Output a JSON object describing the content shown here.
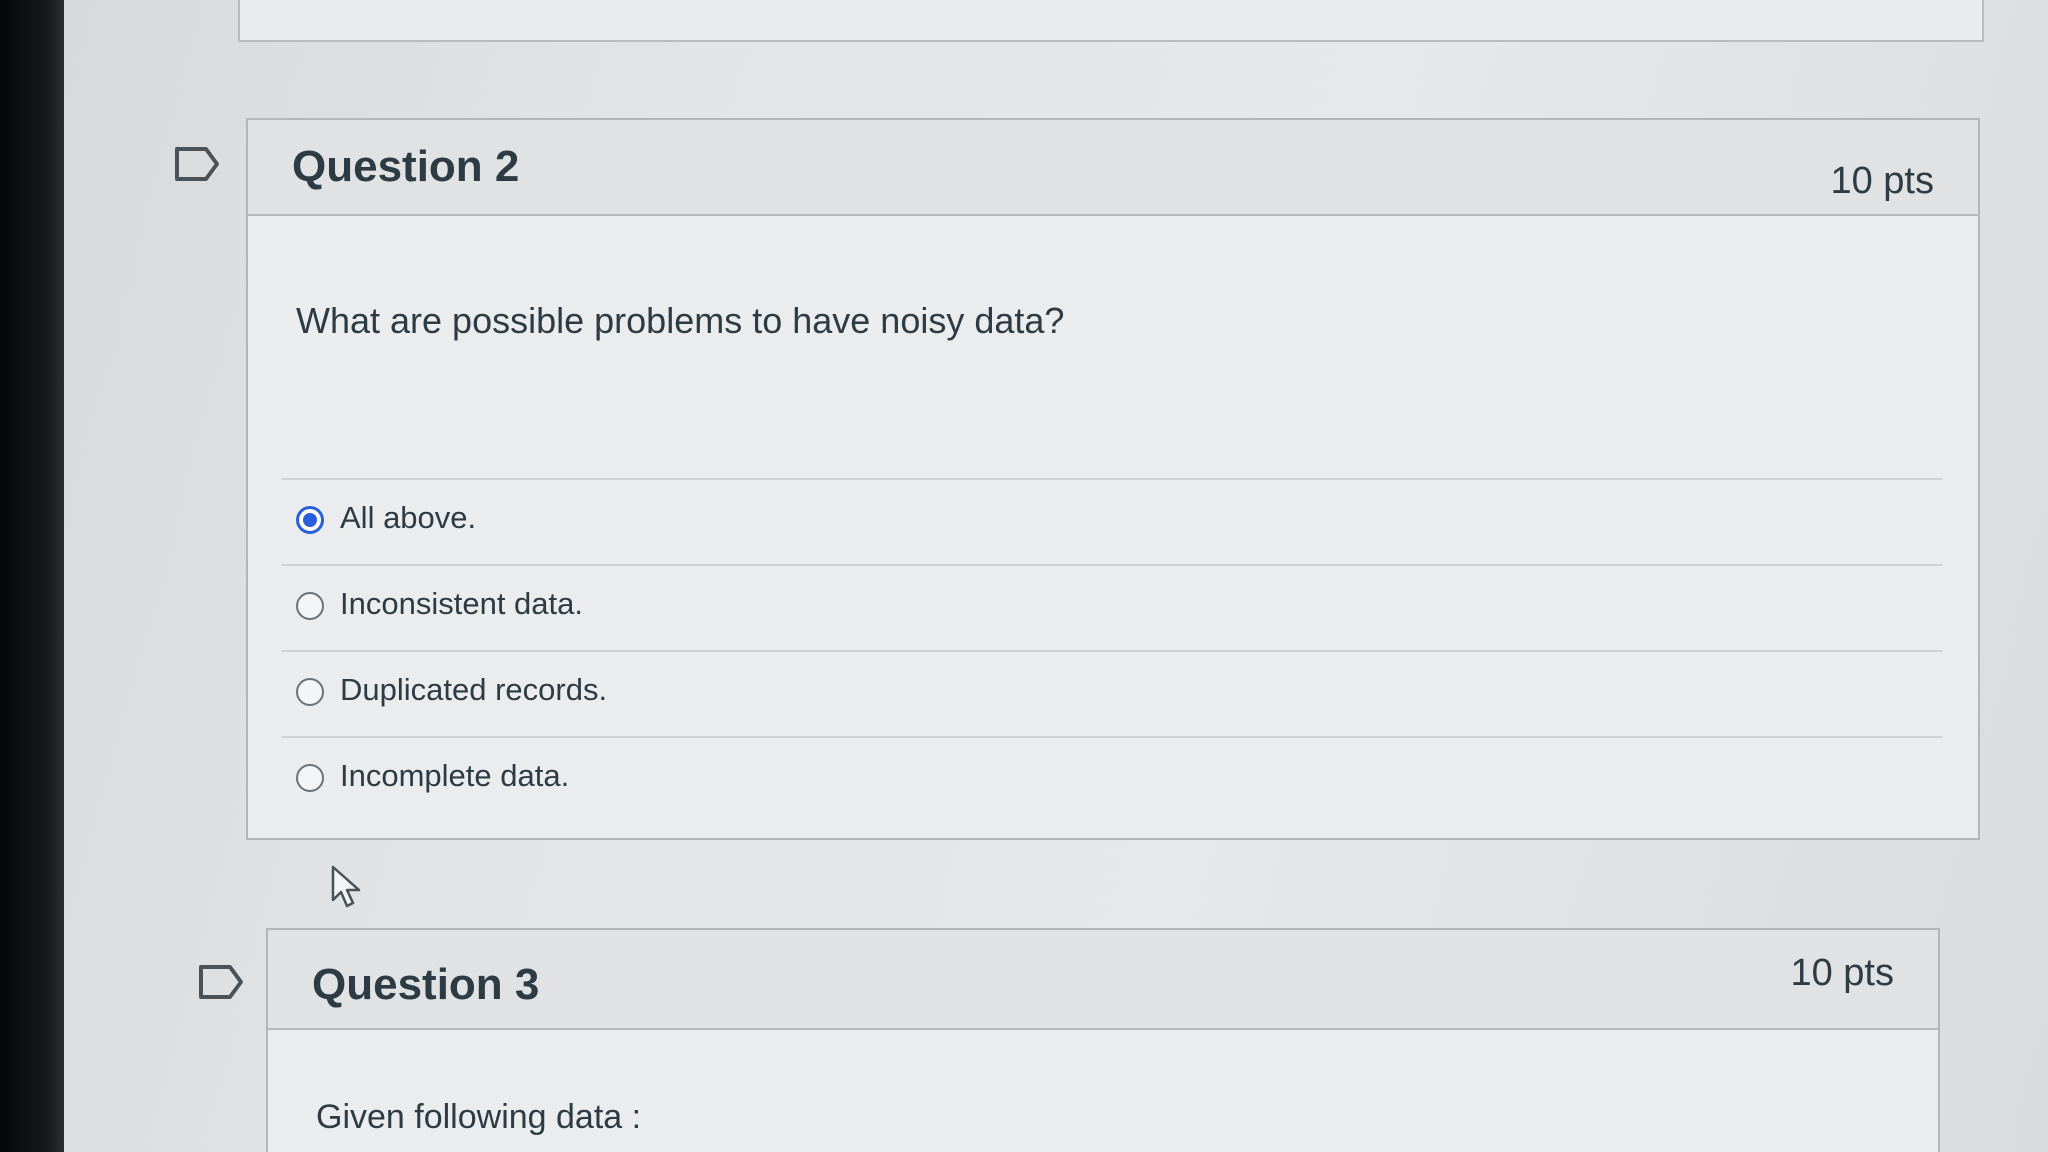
{
  "questions": [
    {
      "title": "Question 2",
      "points": "10 pts",
      "text": "What are possible problems to have noisy data?",
      "answers": [
        {
          "label": "All above.",
          "selected": true
        },
        {
          "label": "Inconsistent data.",
          "selected": false
        },
        {
          "label": "Duplicated records.",
          "selected": false
        },
        {
          "label": "Incomplete data.",
          "selected": false
        }
      ]
    },
    {
      "title": "Question 3",
      "points": "10 pts",
      "text": "Given following data :"
    }
  ],
  "icons": {
    "flag": "flag-bookmark-icon",
    "cursor": "mouse-pointer-icon"
  },
  "colors": {
    "radio_selected": "#2b5fd9",
    "text": "#2d3b45",
    "header_bg": "#e0e2e3"
  }
}
